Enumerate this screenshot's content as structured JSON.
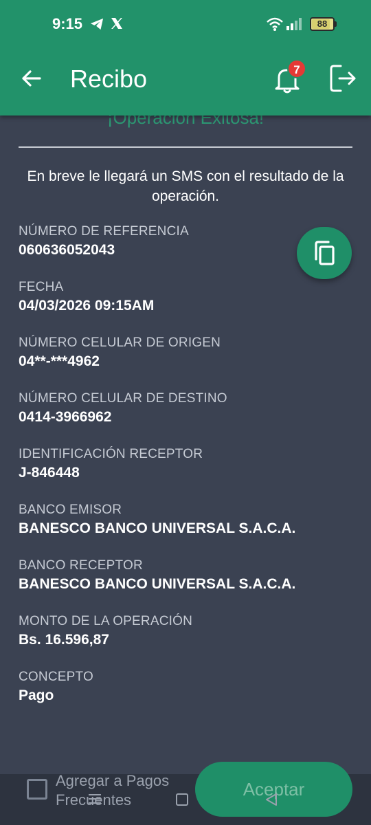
{
  "status_bar": {
    "time": "9:15",
    "battery": "88",
    "battery_level": 0.88
  },
  "header": {
    "title": "Recibo",
    "notification_count": "7"
  },
  "receipt": {
    "success_title": "¡Operación Exitosa!",
    "sms_notice": "En breve le llegará un SMS con el resultado de la operación.",
    "fields": [
      {
        "label": "NÚMERO DE REFERENCIA",
        "value": "060636052043"
      },
      {
        "label": "FECHA",
        "value": "04/03/2026 09:15AM"
      },
      {
        "label": "NÚMERO CELULAR DE ORIGEN",
        "value": "04**-***4962"
      },
      {
        "label": "NÚMERO CELULAR DE DESTINO",
        "value": "0414-3966962"
      },
      {
        "label": "IDENTIFICACIÓN RECEPTOR",
        "value": "J-846448"
      },
      {
        "label": "BANCO EMISOR",
        "value": "BANESCO BANCO UNIVERSAL S.A.C.A."
      },
      {
        "label": "BANCO RECEPTOR",
        "value": "BANESCO BANCO UNIVERSAL S.A.C.A."
      },
      {
        "label": "MONTO DE LA OPERACIÓN",
        "value": "Bs. 16.596,87"
      },
      {
        "label": "CONCEPTO",
        "value": "Pago"
      }
    ]
  },
  "footer": {
    "checkbox_label": "Agregar a Pagos Frecuentes",
    "checkbox_checked": false,
    "accept_label": "Aceptar"
  },
  "icons": {
    "back": "arrow-left-icon",
    "notifications": "bell-icon",
    "logout": "logout-icon",
    "copy": "copy-icon"
  },
  "colors": {
    "primary": "#22926a",
    "background": "#3b4252",
    "badge": "#e53935"
  }
}
